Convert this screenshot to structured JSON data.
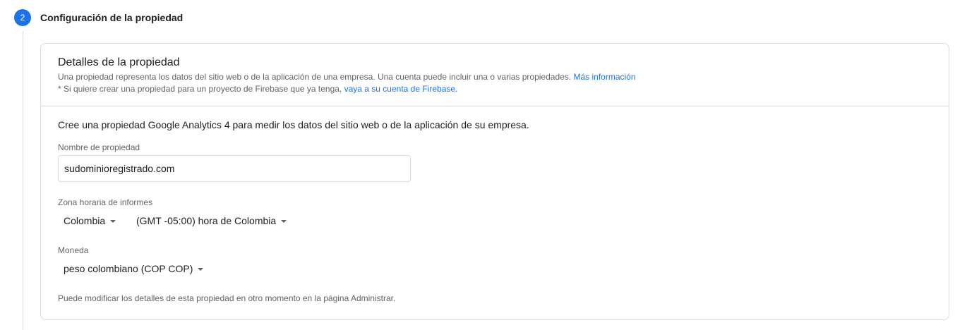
{
  "step": {
    "number": "2",
    "title": "Configuración de la propiedad"
  },
  "card": {
    "title": "Detalles de la propiedad",
    "desc_line1_text": "Una propiedad representa los datos del sitio web o de la aplicación de una empresa. Una cuenta puede incluir una o varias propiedades.",
    "desc_line1_link": "Más información",
    "desc_line2_text": "* Si quiere crear una propiedad para un proyecto de Firebase que ya tenga,",
    "desc_line2_link": "vaya a su cuenta de Firebase."
  },
  "form": {
    "intro": "Cree una propiedad Google Analytics 4 para medir los datos del sitio web o de la aplicación de su empresa.",
    "property_name_label": "Nombre de propiedad",
    "property_name_value": "sudominioregistrado.com",
    "timezone_label": "Zona horaria de informes",
    "country_selected": "Colombia",
    "timezone_selected": "(GMT -05:00) hora de Colombia",
    "currency_label": "Moneda",
    "currency_selected": "peso colombiano (COP COP)",
    "footer_note": "Puede modificar los detalles de esta propiedad en otro momento en la página Administrar."
  },
  "colors": {
    "accent": "#1a73e8",
    "border": "#dadce0",
    "text_primary": "#202124",
    "text_secondary": "#5f6368"
  },
  "icons": {
    "dropdown": "caret-down-icon"
  }
}
